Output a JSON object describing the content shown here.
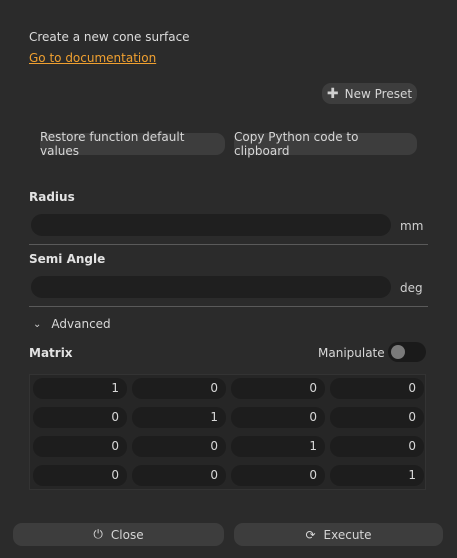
{
  "header": {
    "description": "Create a new cone surface",
    "doc_link": "Go to documentation"
  },
  "buttons": {
    "new_preset": "New Preset",
    "restore": "Restore function default values",
    "copy_python": "Copy Python code to clipboard",
    "close": "Close",
    "execute": "Execute"
  },
  "fields": {
    "radius": {
      "label": "Radius",
      "value": "",
      "unit": "mm"
    },
    "semi_angle": {
      "label": "Semi Angle",
      "value": "",
      "unit": "deg"
    }
  },
  "advanced": {
    "label": "Advanced",
    "matrix_label": "Matrix",
    "manipulate_label": "Manipulate",
    "manipulate_on": false,
    "matrix": [
      [
        "1",
        "0",
        "0",
        "0"
      ],
      [
        "0",
        "1",
        "0",
        "0"
      ],
      [
        "0",
        "0",
        "1",
        "0"
      ],
      [
        "0",
        "0",
        "0",
        "1"
      ]
    ]
  },
  "colors": {
    "accent_link": "#f0a030",
    "background": "#2b2b2b"
  },
  "icons": {
    "new_preset": "plus-icon",
    "close": "power-icon",
    "execute": "refresh-icon",
    "advanced": "chevron-down-icon"
  }
}
